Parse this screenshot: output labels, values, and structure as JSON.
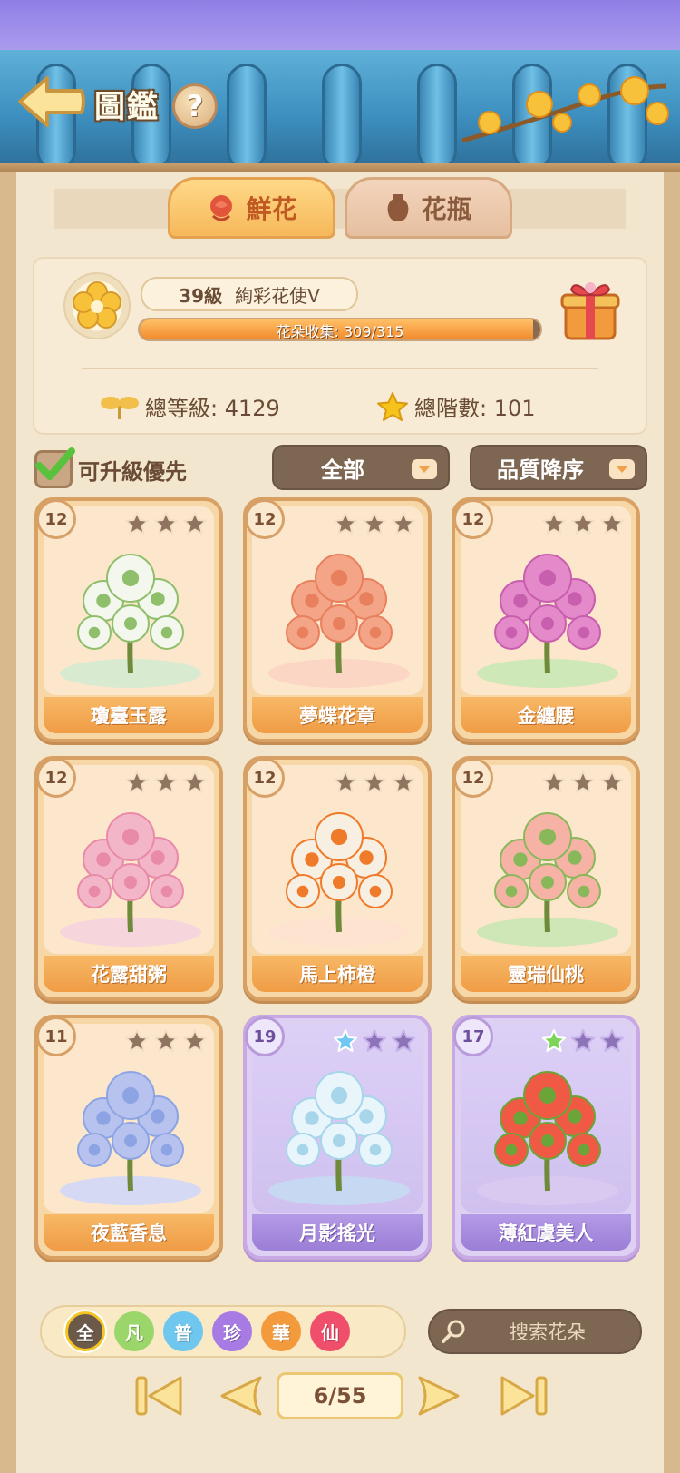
{
  "header": {
    "title": "圖鑑",
    "help": "?"
  },
  "tabs": [
    {
      "label": "鮮花",
      "icon": "rose-icon",
      "active": true
    },
    {
      "label": "花瓶",
      "icon": "vase-icon",
      "active": false
    }
  ],
  "player": {
    "level": "39級",
    "rank": "絢彩花使V",
    "collection_label": "花朵收集: 309/315",
    "collection_fraction": 0.981,
    "total_level": "總等級: 4129",
    "total_tier": "總階數: 101"
  },
  "filters": {
    "upgradable_priority": "可升級優先",
    "upgradable_checked": true,
    "category": "全部",
    "sort": "品質降序"
  },
  "cards": [
    {
      "level": "12",
      "name": "瓊臺玉露",
      "filled_stars": 0,
      "star_color": "",
      "theme": "orange"
    },
    {
      "level": "12",
      "name": "夢蝶花章",
      "filled_stars": 0,
      "star_color": "",
      "theme": "orange"
    },
    {
      "level": "12",
      "name": "金纏腰",
      "filled_stars": 0,
      "star_color": "",
      "theme": "orange"
    },
    {
      "level": "12",
      "name": "花露甜粥",
      "filled_stars": 0,
      "star_color": "",
      "theme": "orange"
    },
    {
      "level": "12",
      "name": "馬上柿橙",
      "filled_stars": 0,
      "star_color": "",
      "theme": "orange"
    },
    {
      "level": "12",
      "name": "靈瑞仙桃",
      "filled_stars": 0,
      "star_color": "",
      "theme": "orange"
    },
    {
      "level": "11",
      "name": "夜藍香息",
      "filled_stars": 0,
      "star_color": "",
      "theme": "orange"
    },
    {
      "level": "19",
      "name": "月影搖光",
      "filled_stars": 1,
      "star_color": "#6fc7f2",
      "theme": "purple"
    },
    {
      "level": "17",
      "name": "薄紅虞美人",
      "filled_stars": 1,
      "star_color": "#7fd45a",
      "theme": "purple"
    }
  ],
  "rarity_filters": [
    {
      "label": "全",
      "color": "#6b5a4a",
      "selected": true
    },
    {
      "label": "凡",
      "color": "#9ad66a",
      "selected": false
    },
    {
      "label": "普",
      "color": "#6fc6ee",
      "selected": false
    },
    {
      "label": "珍",
      "color": "#a77be3",
      "selected": false
    },
    {
      "label": "華",
      "color": "#f39a3c",
      "selected": false
    },
    {
      "label": "仙",
      "color": "#ef4f6a",
      "selected": false
    }
  ],
  "search": {
    "placeholder": "搜索花朵"
  },
  "pagination": {
    "label": "6/55"
  }
}
